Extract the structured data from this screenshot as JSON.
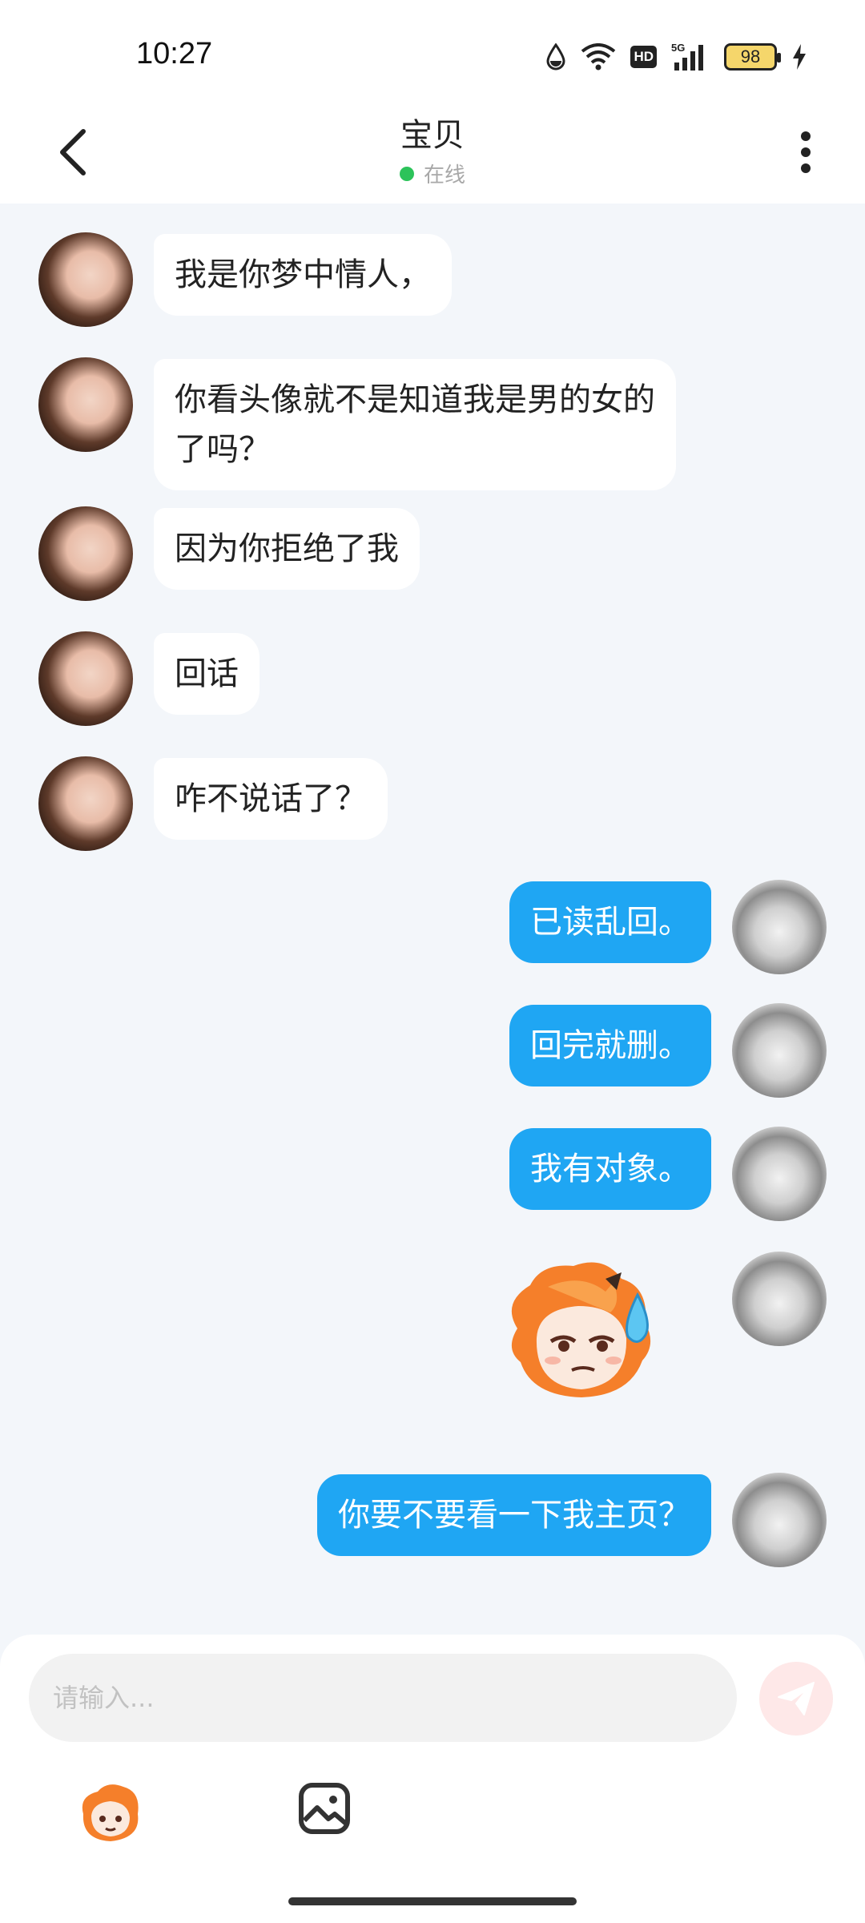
{
  "status_bar": {
    "time": "10:27",
    "battery": "98",
    "network": "5G",
    "hd": "HD"
  },
  "header": {
    "title": "宝贝",
    "status": "在线"
  },
  "messages": [
    {
      "from": "contact",
      "text": "我是你梦中情人，"
    },
    {
      "from": "contact",
      "text": "你看头像就不是知道我是男的女的\n了吗？"
    },
    {
      "from": "contact",
      "text": "因为你拒绝了我"
    },
    {
      "from": "contact",
      "text": "回话"
    },
    {
      "from": "contact",
      "text": "咋不说话了？"
    },
    {
      "from": "me",
      "text": "已读乱回。"
    },
    {
      "from": "me",
      "text": "回完就删。"
    },
    {
      "from": "me",
      "text": "我有对象。"
    },
    {
      "from": "me",
      "type": "sticker"
    },
    {
      "from": "me",
      "text": "你要不要看一下我主页？"
    }
  ],
  "composer": {
    "placeholder": "请输入..."
  },
  "colors": {
    "outgoing_bubble": "#1FA6F3",
    "incoming_bubble": "#FFFFFF",
    "online": "#2CC35A",
    "background": "#F3F6FA"
  },
  "icons": [
    "back-arrow-icon",
    "more-vertical-icon",
    "send-icon",
    "emoji-sticker-icon",
    "image-icon"
  ]
}
